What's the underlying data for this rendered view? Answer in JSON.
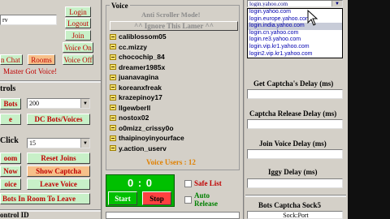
{
  "left": {
    "top_field": "rv",
    "buttons": {
      "login": "Login",
      "logout": "Logout",
      "join": "Join",
      "voice_on": "Voice On",
      "voice_off": "Voice Off",
      "chat": "n Chat 3",
      "rooms": "Rooms",
      "master_voice": "Master Got Voice!",
      "bots": "Bots",
      "e": "e",
      "dc_bots": "DC Bots/Voices",
      "room": "oom",
      "reset_joins": "Reset Joins",
      "now": "Now",
      "show_captcha": "Show Captcha",
      "voice": "oice",
      "leave_voice": "Leave Voice",
      "bots_in_room_leave": "Bots In Room To Leave"
    },
    "controls_label": "trols",
    "bots_select": "200",
    "click_label": "Click",
    "click_select": "15",
    "bottom_label": "ontrol ID"
  },
  "voice": {
    "title": "Voice",
    "anti_scroller": "Anti Scroller Mode!",
    "ignore_button": "^^ Ignore This Lamer ^^",
    "users": [
      "caliblossom05",
      "cc.mizzy",
      "chocochip_84",
      "dreamer1985x",
      "juanavagina",
      "koreanxfreak",
      "krazepinoy17",
      "llgewberll",
      "nostox02",
      "o0mizz_crissy0o",
      "thaipinoyinyourface",
      "y.action_userv"
    ],
    "voice_users_label": "Voice Users : 12"
  },
  "timer": {
    "value": "0 : 0",
    "start": "Start",
    "stop": "Stop"
  },
  "options": {
    "safe_list": "Safe List",
    "auto_release": "Auto Release"
  },
  "right": {
    "login_select": "login.yahoo.com",
    "login_options": [
      "login.yahoo.com",
      "login.europe.yahoo.com",
      "login.india.yahoo.com",
      "login.cn.yahoo.com",
      "login.re3.yahoo.com",
      "login.vip.kr1.yahoo.com",
      "login2.vip.kr1.yahoo.com"
    ],
    "captcha_delay": "Get Captcha's Delay (ms)",
    "captcha_release_delay": "Captcha Release Delay (ms)",
    "join_voice_delay": "Join Voice Delay (ms)",
    "iggy_delay": "Iggy Delay (ms)",
    "sock5_title": "Bots Captcha Sock5",
    "sock_port": "Sock:Port"
  },
  "colors": {
    "window_bg": "#d4d0c8",
    "timer_green": "#00c000",
    "voice_users_orange": "#e08000",
    "title_grey": "#8a8a8a"
  }
}
